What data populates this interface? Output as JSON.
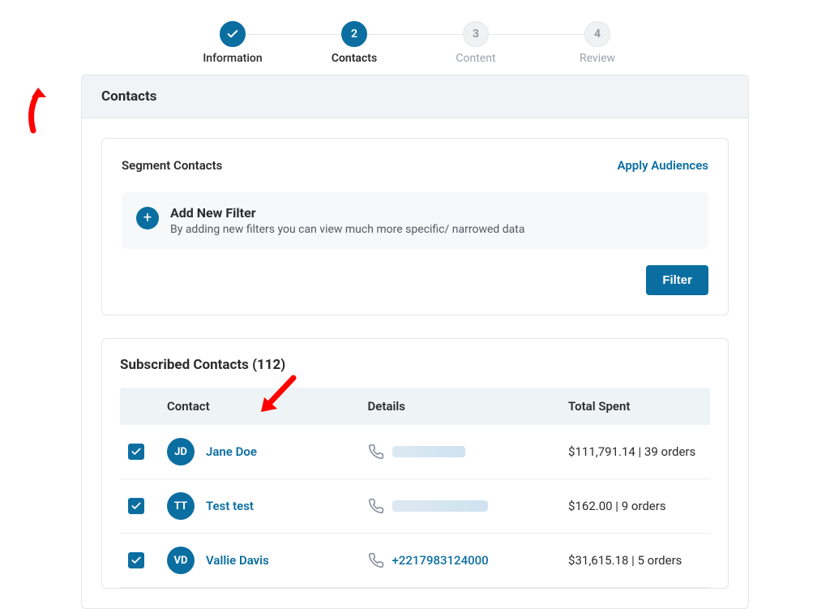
{
  "stepper": {
    "steps": [
      {
        "number": "1",
        "label": "Information",
        "state": "completed"
      },
      {
        "number": "2",
        "label": "Contacts",
        "state": "current"
      },
      {
        "number": "3",
        "label": "Content",
        "state": "upcoming"
      },
      {
        "number": "4",
        "label": "Review",
        "state": "upcoming"
      }
    ]
  },
  "page": {
    "header_title": "Contacts"
  },
  "segment_panel": {
    "title": "Segment Contacts",
    "apply_audiences_label": "Apply Audiences",
    "add_filter": {
      "title": "Add New Filter",
      "description": "By adding new filters you can view much more specific/ narrowed data"
    },
    "filter_button_label": "Filter"
  },
  "contacts_panel": {
    "title": "Subscribed Contacts",
    "count": 112,
    "columns": {
      "contact": "Contact",
      "details": "Details",
      "total_spent": "Total Spent"
    },
    "rows": [
      {
        "initials": "JD",
        "name": "Jane Doe",
        "phone": null,
        "phone_redacted": true,
        "total_spent": "$111,791.14",
        "orders": 39,
        "checked": true
      },
      {
        "initials": "TT",
        "name": "Test test",
        "phone": null,
        "phone_redacted": true,
        "total_spent": "$162.00",
        "orders": 9,
        "checked": true
      },
      {
        "initials": "VD",
        "name": "Vallie Davis",
        "phone": "+2217983124000",
        "phone_redacted": false,
        "total_spent": "$31,615.18",
        "orders": 5,
        "checked": true
      }
    ]
  },
  "colors": {
    "accent": "#0b6ea1",
    "annotation": "#ff0000"
  }
}
